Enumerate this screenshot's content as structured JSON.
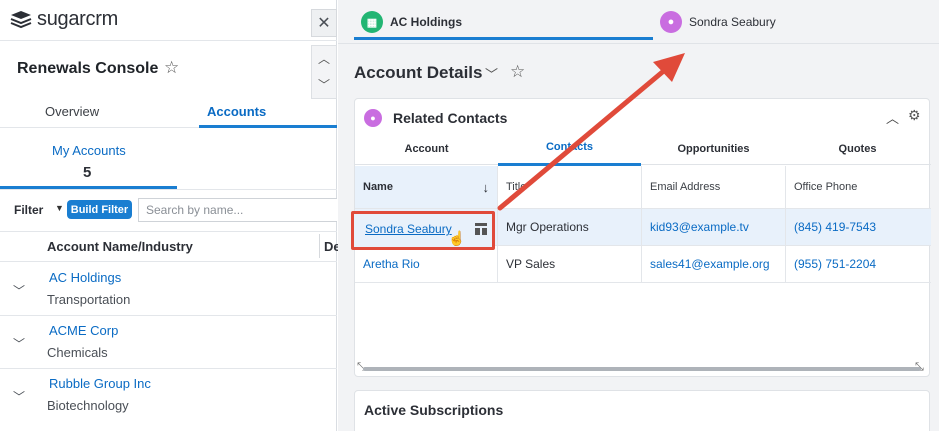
{
  "app": {
    "logo_text": "sugarcrm",
    "close_label": "✕"
  },
  "console": {
    "title": "Renewals Console"
  },
  "left_tabs": {
    "overview": "Overview",
    "accounts": "Accounts"
  },
  "my_accounts": {
    "label": "My Accounts",
    "count": "5"
  },
  "filter": {
    "label": "Filter",
    "build_filter": "Build Filter",
    "search_placeholder": "Search by name..."
  },
  "accounts_table": {
    "col_name": "Account Name/Industry",
    "col_2": "De",
    "rows": [
      {
        "name": "AC Holdings",
        "industry": "Transportation"
      },
      {
        "name": "ACME Corp",
        "industry": "Chemicals"
      },
      {
        "name": "Rubble Group Inc",
        "industry": "Biotechnology"
      }
    ]
  },
  "top_tabs": [
    {
      "label": "AC Holdings",
      "icon": "building-icon",
      "color": "#22b573"
    },
    {
      "label": "Sondra Seabury",
      "icon": "person-icon",
      "color": "#c96de0"
    }
  ],
  "account_details": {
    "title": "Account Details"
  },
  "related_contacts": {
    "title": "Related Contacts",
    "subtabs": [
      "Account",
      "Contacts",
      "Opportunities",
      "Quotes"
    ],
    "columns": [
      "Name",
      "Title",
      "Email Address",
      "Office Phone"
    ],
    "rows": [
      {
        "name": "Sondra Seabury",
        "title": "Mgr Operations",
        "email": "kid93@example.tv",
        "phone": "(845) 419-7543"
      },
      {
        "name": "Aretha Rio",
        "title": "VP Sales",
        "email": "sales41@example.org",
        "phone": "(955) 751-2204"
      }
    ]
  },
  "active_subscriptions": {
    "title": "Active Subscriptions"
  },
  "colors": {
    "accent": "#1a7ed1",
    "link": "#0a6bc4",
    "highlight": "#e04a3a"
  }
}
